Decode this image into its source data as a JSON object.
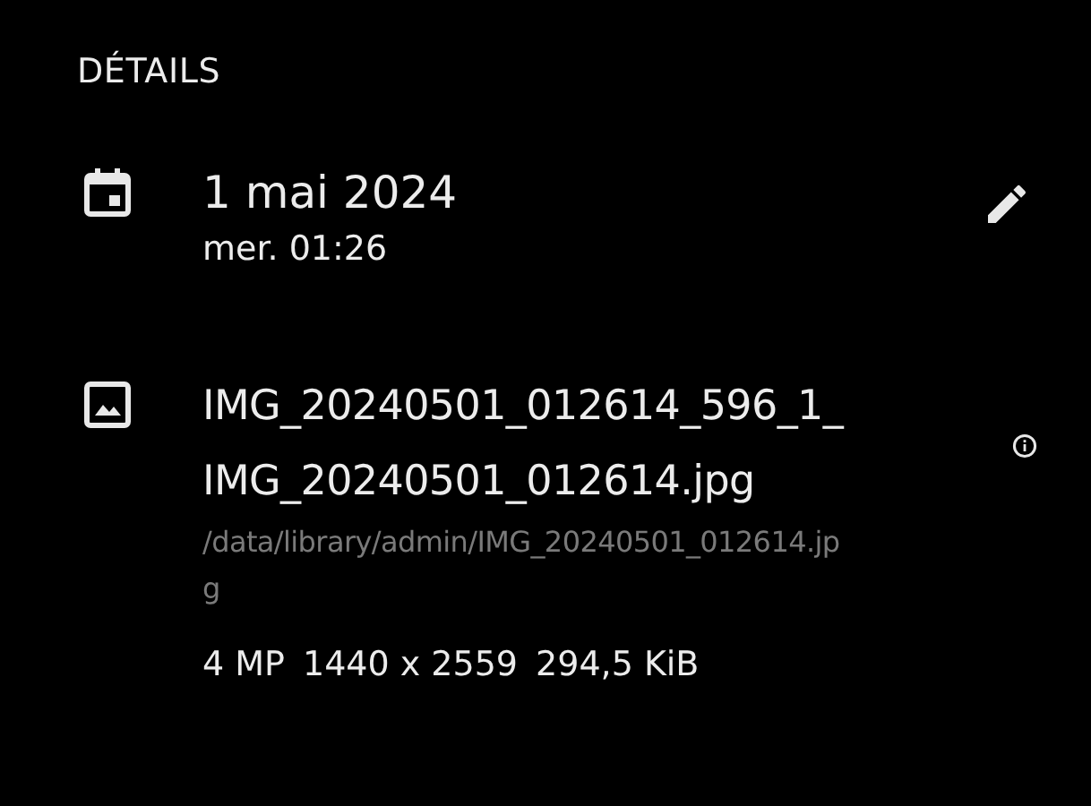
{
  "section_title": "DÉTAILS",
  "date": {
    "date": "1 mai 2024",
    "time": "mer. 01:26"
  },
  "file": {
    "name_lines": [
      "IMG_20240501_012614_596_1_",
      "IMG_20240501_012614.jpg"
    ],
    "path_lines": [
      "/data/library/admin/IMG_20240501_012614.jp",
      "g"
    ],
    "meta": [
      "4 MP",
      "1440 x 2559",
      "294,5 KiB"
    ]
  }
}
